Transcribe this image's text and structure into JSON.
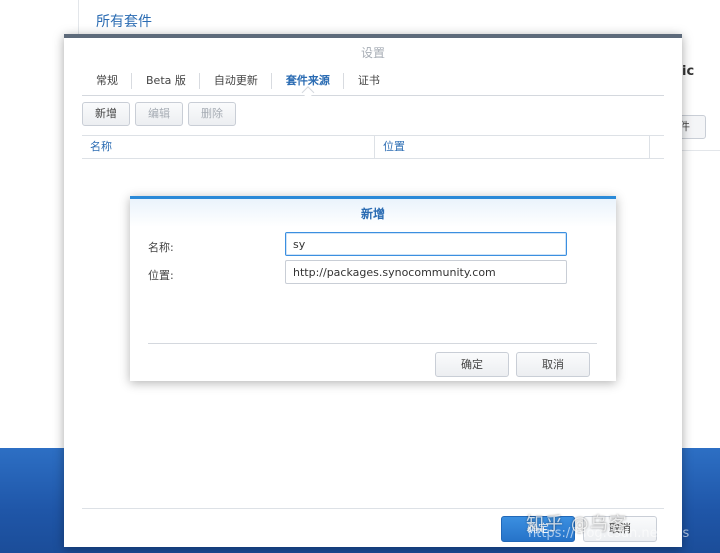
{
  "background_app": {
    "title": "所有套件",
    "partial_letter": "ic",
    "side_button_label": "件"
  },
  "settings": {
    "title": "设置",
    "tabs": [
      {
        "label": "常规",
        "active": false
      },
      {
        "label": "Beta 版",
        "active": false
      },
      {
        "label": "自动更新",
        "active": false
      },
      {
        "label": "套件来源",
        "active": true
      },
      {
        "label": "证书",
        "active": false
      }
    ],
    "toolbar": {
      "add_label": "新增",
      "edit_label": "编辑",
      "delete_label": "删除"
    },
    "table": {
      "columns": [
        "名称",
        "位置"
      ]
    },
    "footer": {
      "ok_label": "确定",
      "cancel_label": "取消"
    }
  },
  "dialog": {
    "title": "新增",
    "name_label": "名称:",
    "name_value": "sy",
    "location_label": "位置:",
    "location_value": "http://packages.synocommunity.com",
    "ok_label": "确定",
    "cancel_label": "取消"
  },
  "watermark": {
    "text": "知乎 @乌客",
    "url": "https://blog.csdn.net/yys"
  },
  "colors": {
    "accent": "#2b6cb3",
    "primary_button": "#2673c9",
    "desktop": "#1f56a8"
  }
}
